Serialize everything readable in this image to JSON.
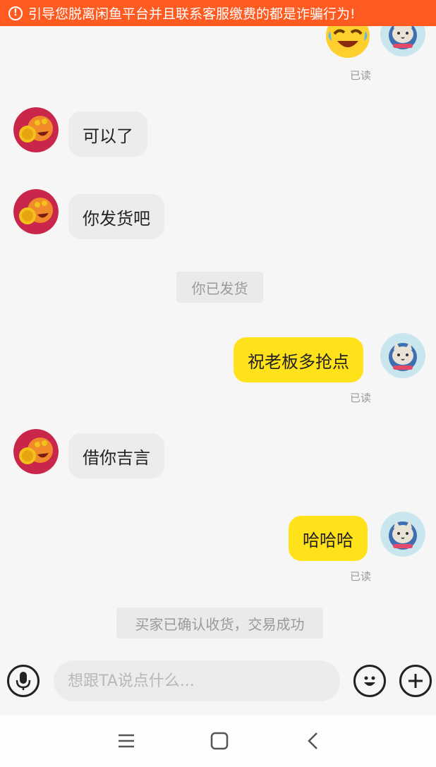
{
  "banner": {
    "icon": "warning-icon",
    "text": "引导您脱离闲鱼平台并且联系客服缴费的都是诈骗行为!"
  },
  "messages": [
    {
      "side": "right",
      "type": "emoji",
      "icon": "laughing-crying-emoji-icon",
      "read": "已读"
    },
    {
      "side": "left",
      "text": "可以了"
    },
    {
      "side": "left",
      "text": "你发货吧"
    },
    {
      "side": "system",
      "text": "你已发货"
    },
    {
      "side": "right",
      "text": "祝老板多抢点",
      "read": "已读"
    },
    {
      "side": "left",
      "text": "借你吉言"
    },
    {
      "side": "right",
      "text": "哈哈哈",
      "read": "已读"
    },
    {
      "side": "system",
      "text": "买家已确认收货，交易成功"
    }
  ],
  "input": {
    "placeholder": "想跟TA说点什么...",
    "voice_icon": "microphone-icon",
    "emoji_icon": "smiley-icon",
    "more_icon": "plus-icon"
  },
  "nav": {
    "menu_icon": "menu-icon",
    "home_icon": "home-square-icon",
    "back_icon": "back-chevron-icon"
  },
  "colors": {
    "banner": "#ff5a1f",
    "own_bubble": "#ffe21a",
    "other_bubble": "#ececef",
    "background": "#f6f6f7"
  }
}
